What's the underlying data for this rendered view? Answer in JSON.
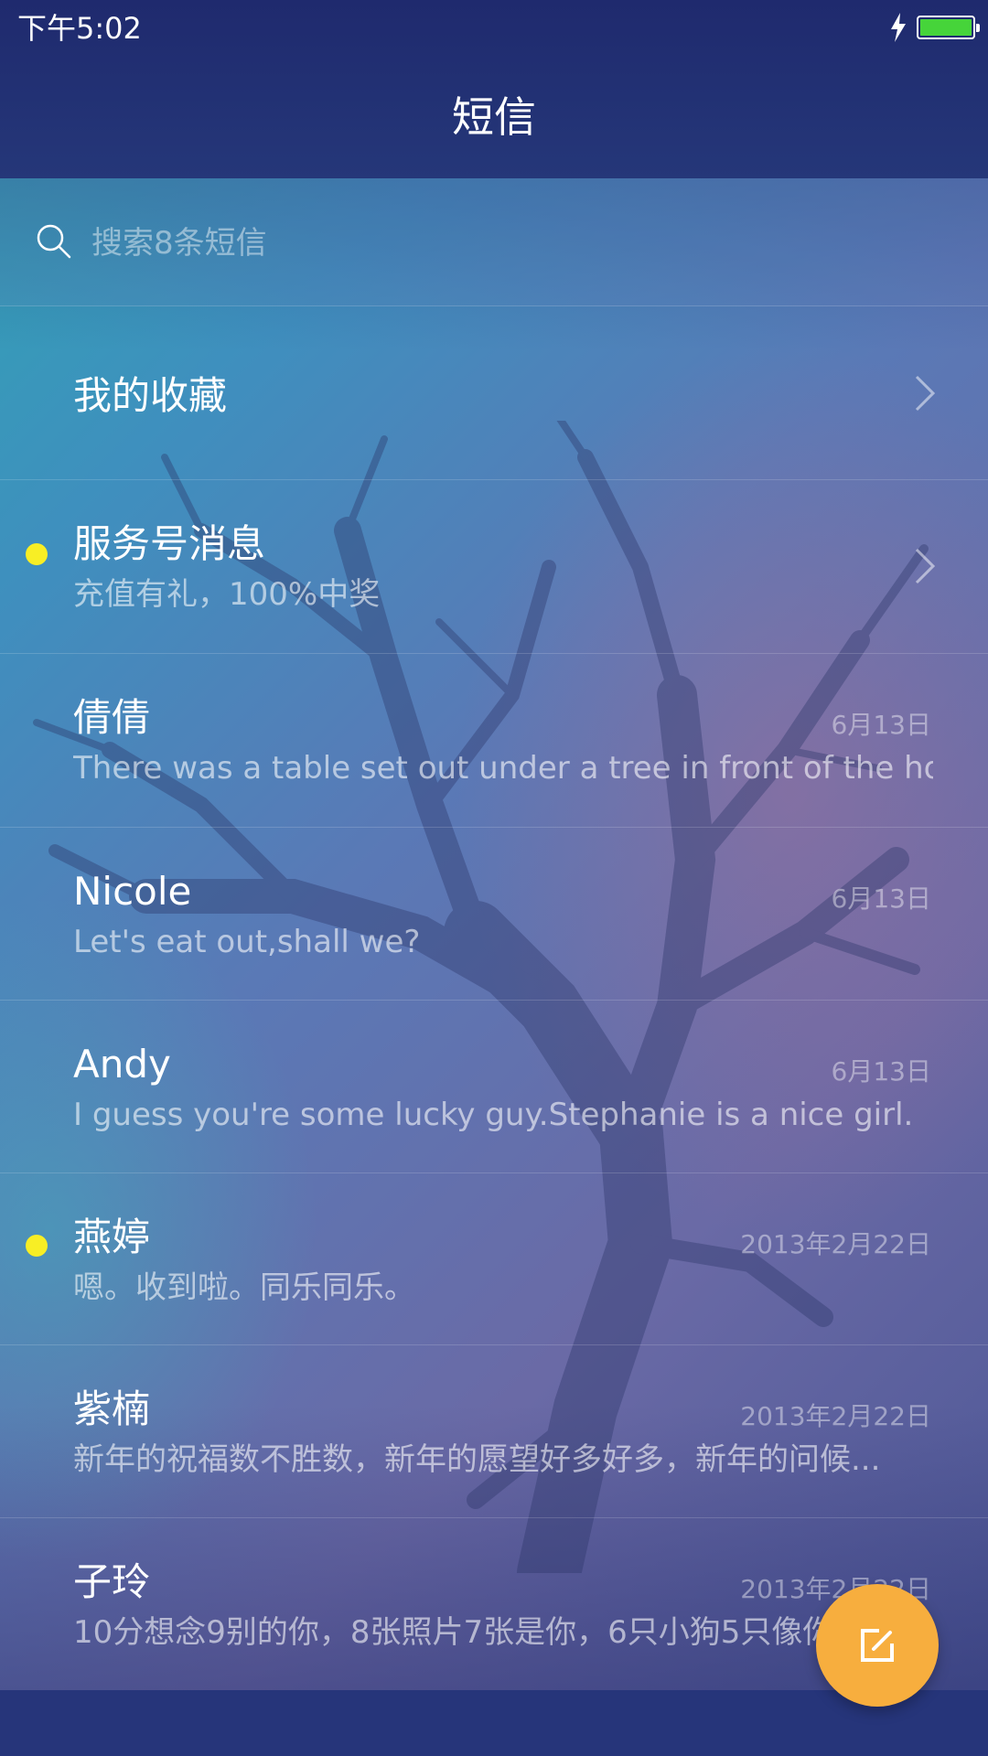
{
  "status_bar": {
    "time": "下午5:02",
    "charging_icon": "lightning-bolt-icon",
    "battery_level": 1.0,
    "battery_color": "#46d43a"
  },
  "header": {
    "title": "短信"
  },
  "search": {
    "placeholder": "搜索8条短信",
    "value": ""
  },
  "conversations": [
    {
      "name": "我的收藏",
      "preview": "",
      "date": "",
      "unread": false,
      "chevron": true
    },
    {
      "name": "服务号消息",
      "preview": "充值有礼，100%中奖",
      "date": "",
      "unread": true,
      "chevron": true
    },
    {
      "name": "倩倩",
      "preview": "There was a table set out under a tree in front of the ho...",
      "date": "6月13日",
      "unread": false,
      "chevron": false
    },
    {
      "name": "Nicole",
      "preview": "Let's eat out,shall we?",
      "date": "6月13日",
      "unread": false,
      "chevron": false
    },
    {
      "name": "Andy",
      "preview": "I guess you're some lucky guy.Stephanie is a nice girl.",
      "date": "6月13日",
      "unread": false,
      "chevron": false
    },
    {
      "name": "燕婷",
      "preview": "嗯。收到啦。同乐同乐。",
      "date": "2013年2月22日",
      "unread": true,
      "chevron": false
    },
    {
      "name": "紫楠",
      "preview": "新年的祝福数不胜数，新年的愿望好多好多，新年的问候...",
      "date": "2013年2月22日",
      "unread": false,
      "chevron": false
    },
    {
      "name": "子玲",
      "preview": "10分想念9别的你，8张照片7张是你，6只小狗5只像你",
      "date": "2013年2月22日",
      "unread": false,
      "chevron": false
    }
  ],
  "fab": {
    "icon": "compose-icon",
    "color": "#f7ae3e"
  },
  "colors": {
    "unread_dot": "#f8ee25",
    "header": "#1f2a6e"
  }
}
